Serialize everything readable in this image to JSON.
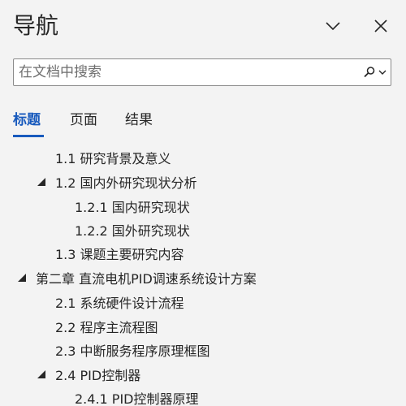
{
  "pane": {
    "title": "导航"
  },
  "search": {
    "placeholder": "在文档中搜索",
    "value": ""
  },
  "tabs": [
    {
      "label": "标题",
      "active": true
    },
    {
      "label": "页面",
      "active": false
    },
    {
      "label": "结果",
      "active": false
    }
  ],
  "headings": [
    {
      "text": "1.1 研究背景及意义",
      "level": 2,
      "expandable": false
    },
    {
      "text": "1.2 国内外研究现状分析",
      "level": 2,
      "expandable": true,
      "expanded": true
    },
    {
      "text": "1.2.1 国内研究现状",
      "level": 3,
      "expandable": false
    },
    {
      "text": "1.2.2 国外研究现状",
      "level": 3,
      "expandable": false
    },
    {
      "text": "1.3 课题主要研究内容",
      "level": 2,
      "expandable": false
    },
    {
      "text": "第二章 直流电机PID调速系统设计方案",
      "level": 1,
      "expandable": true,
      "expanded": true
    },
    {
      "text": "2.1 系统硬件设计流程",
      "level": 2,
      "expandable": false
    },
    {
      "text": "2.2 程序主流程图",
      "level": 2,
      "expandable": false
    },
    {
      "text": "2.3 中断服务程序原理框图",
      "level": 2,
      "expandable": false
    },
    {
      "text": "2.4 PID控制器",
      "level": 2,
      "expandable": true,
      "expanded": true
    },
    {
      "text": "2.4.1 PID控制器原理",
      "level": 3,
      "expandable": false
    }
  ],
  "colors": {
    "accent": "#185abd",
    "background": "#f3f3f3",
    "text": "#262626"
  }
}
